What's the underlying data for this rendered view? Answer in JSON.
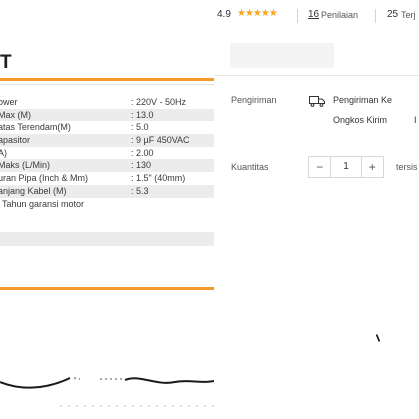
{
  "spec": {
    "title": "T",
    "rows": [
      {
        "label": "ower",
        "value": ": 220V - 50Hz"
      },
      {
        "label": "Max (M)",
        "value": ": 13.0"
      },
      {
        "label": "atas Terendam(M)",
        "value": ": 5.0"
      },
      {
        "label": "apasitor",
        "value": ": 9 µF 450VAC"
      },
      {
        "label": "A)",
        "value": ": 2.00"
      },
      {
        "label": "Maks (L/Min)",
        "value": ": 130"
      },
      {
        "label": "uran Pipa (Inch & Mm)",
        "value": ": 1.5\" (40mm)"
      },
      {
        "label": "anjang Kabel (M)",
        "value": ": 5.3"
      },
      {
        "label": "Tahun garansi motor",
        "value": ""
      }
    ]
  },
  "rating": {
    "score": "4.9",
    "stars": "★★★★★",
    "reviews_count": "16",
    "reviews_label": "Penilaian",
    "sold_count": "25",
    "sold_label": "Terj"
  },
  "shipping": {
    "label": "Pengiriman",
    "destination": "Pengiriman Ke",
    "cost_label": "Ongkos Kirim",
    "cost_extra": "I"
  },
  "quantity": {
    "label": "Kuantitas",
    "minus": "−",
    "value": "1",
    "plus": "+",
    "stock": "tersis"
  },
  "colors": {
    "accent": "#f29a2e",
    "stars": "#f5a623"
  }
}
